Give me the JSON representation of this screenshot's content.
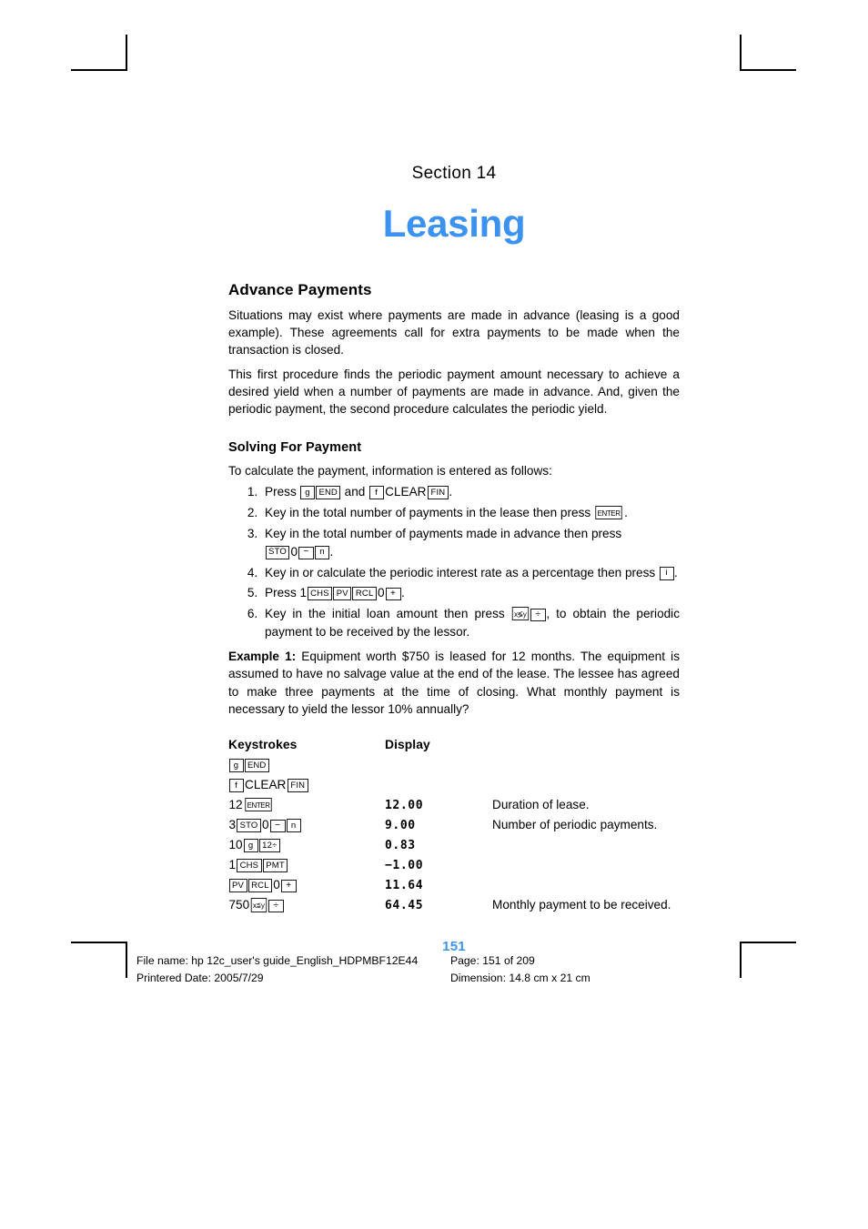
{
  "page": {
    "section_label": "Section 14",
    "chapter_title": "Leasing",
    "page_number": "151"
  },
  "advance_payments": {
    "heading": "Advance Payments",
    "paragraph_1": "Situations may exist where payments are made in advance (leasing is a good example). These agreements call for extra payments to be made when the transaction is closed.",
    "paragraph_2": "This first procedure finds the periodic payment amount necessary to achieve a desired yield when a number of payments are made in advance. And, given the periodic payment, the second procedure calculates the periodic yield."
  },
  "solving_for_payment": {
    "subheading": "Solving For Payment",
    "intro": "To calculate the payment, information is entered as follows:",
    "steps": [
      {
        "num": "1.",
        "text_before": "Press",
        "keys": [
          "g",
          "END"
        ],
        "text_mid": "and",
        "keys2": [
          "f",
          "CLEAR",
          "FIN"
        ],
        "text_after": "."
      },
      {
        "num": "2.",
        "text_before": "Key in the total number of payments in the lease then press",
        "keys": [
          "ENTER"
        ],
        "text_after": "."
      },
      {
        "num": "3.",
        "text_before": "Key in the total number of payments made in advance then press",
        "keys": [
          "STO",
          "0",
          "−",
          "n"
        ],
        "text_after": "."
      },
      {
        "num": "4.",
        "text_before": "Key in or calculate the periodic interest rate as a percentage then press",
        "keys": [
          "i"
        ],
        "text_after": "."
      },
      {
        "num": "5.",
        "text_before": "Press 1",
        "keys": [
          "CHS",
          "PV",
          "RCL",
          "0",
          "+"
        ],
        "text_after": "."
      },
      {
        "num": "6.",
        "text_before": "Key in the initial loan amount then press",
        "keys": [
          "x≶y",
          "÷"
        ],
        "text_after": ", to obtain the periodic payment to be received by the lessor."
      }
    ]
  },
  "example": {
    "label": "Example 1:",
    "text": " Equipment worth $750 is leased for 12 months. The equipment is assumed to have no salvage value at the end of the lease. The lessee has agreed to make three payments at the time of closing. What monthly payment is necessary to yield the lessor 10% annually?"
  },
  "keystroke_table": {
    "headers": {
      "keystrokes": "Keystrokes",
      "display": "Display"
    },
    "rows": [
      {
        "keys_text": "g END",
        "display": "",
        "note": ""
      },
      {
        "keys_text": "f CLEAR FIN",
        "display": "",
        "note": ""
      },
      {
        "keys_text": "12 ENTER",
        "display": "12.00",
        "note": "Duration of lease."
      },
      {
        "keys_text": "3 STO 0 − n",
        "display": "9.00",
        "note": "Number of periodic payments."
      },
      {
        "keys_text": "10 g 12÷",
        "display": "0.83",
        "note": ""
      },
      {
        "keys_text": "1 CHS PMT",
        "display": "−1.00",
        "note": ""
      },
      {
        "keys_text": "PV RCL 0 +",
        "display": "11.64",
        "note": ""
      },
      {
        "keys_text": "750 x≶y ÷",
        "display": "64.45",
        "note": "Monthly payment to be received."
      }
    ]
  },
  "footer": {
    "file_name": "File name: hp 12c_user's guide_English_HDPMBF12E44",
    "page_of": "Page: 151 of 209",
    "printed_date": "Printered Date: 2005/7/29",
    "dimension": "Dimension: 14.8 cm x 21 cm"
  },
  "colors": {
    "accent_blue": "#3c92f0",
    "text": "#000000"
  }
}
